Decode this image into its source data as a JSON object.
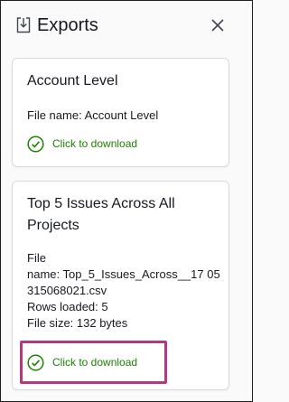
{
  "panel": {
    "title": "Exports",
    "header_icon": "download-icon",
    "close_icon": "close-icon"
  },
  "exports": [
    {
      "title": "Account Level",
      "file_label": "File name: Account Level",
      "download_label": "Click to download"
    },
    {
      "title": "Top 5 Issues Across All Projects",
      "file_label_word": "File",
      "file_name_line": "name: Top_5_Issues_Across__17 05315068021.csv",
      "rows_loaded": "Rows loaded: 5",
      "file_size": "File size: 132 bytes",
      "download_label": "Click to download"
    }
  ],
  "colors": {
    "success_green": "#1d8102",
    "highlight_magenta": "#b03a7d",
    "card_border": "#d9d9d9",
    "text": "#16191f"
  }
}
